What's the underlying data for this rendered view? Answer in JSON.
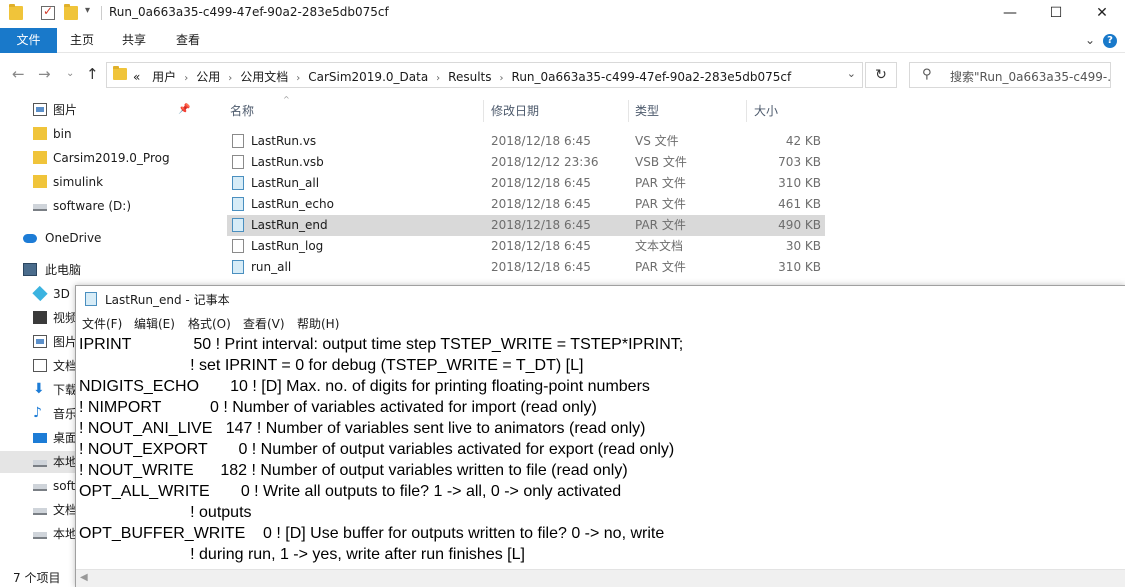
{
  "explorer": {
    "title": "Run_0a663a35-c499-47ef-90a2-283e5db075cf",
    "ribbon_tabs": [
      "文件",
      "主页",
      "共享",
      "查看"
    ],
    "help": "?",
    "address": {
      "lead": "«",
      "crumbs": [
        "用户",
        "公用",
        "公用文档",
        "CarSim2019.0_Data",
        "Results",
        "Run_0a663a35-c499-47ef-90a2-283e5db075cf"
      ]
    },
    "search_placeholder": "搜索\"Run_0a663a35-c499-...",
    "nav_items": [
      {
        "label": "图片",
        "icon": "picture-icon",
        "pinned": true
      },
      {
        "label": "bin",
        "icon": "folder-icon"
      },
      {
        "label": "Carsim2019.0_Prog",
        "icon": "folder-icon"
      },
      {
        "label": "simulink",
        "icon": "folder-icon"
      },
      {
        "label": "software (D:)",
        "icon": "drive-icon"
      },
      {
        "label": "OneDrive",
        "icon": "onedrive-icon"
      },
      {
        "label": "此电脑",
        "icon": "this-pc-icon"
      },
      {
        "label": "3D",
        "icon": "3d-objects-icon"
      },
      {
        "label": "视频",
        "icon": "video-icon"
      },
      {
        "label": "图片",
        "icon": "picture-icon"
      },
      {
        "label": "文档",
        "icon": "document-icon"
      },
      {
        "label": "下载",
        "icon": "download-icon"
      },
      {
        "label": "音乐",
        "icon": "music-icon"
      },
      {
        "label": "桌面",
        "icon": "desktop-icon"
      },
      {
        "label": "本地",
        "icon": "drive-icon",
        "selected": true
      },
      {
        "label": "soft",
        "icon": "drive-icon"
      },
      {
        "label": "文档",
        "icon": "drive-icon"
      },
      {
        "label": "本地",
        "icon": "drive-icon"
      }
    ],
    "columns": [
      "名称",
      "修改日期",
      "类型",
      "大小"
    ],
    "files": [
      {
        "name": "LastRun.vs",
        "date": "2018/12/18 6:45",
        "type": "VS 文件",
        "size": "42 KB",
        "par": false
      },
      {
        "name": "LastRun.vsb",
        "date": "2018/12/12 23:36",
        "type": "VSB 文件",
        "size": "703 KB",
        "par": false
      },
      {
        "name": "LastRun_all",
        "date": "2018/12/18 6:45",
        "type": "PAR 文件",
        "size": "310 KB",
        "par": true
      },
      {
        "name": "LastRun_echo",
        "date": "2018/12/18 6:45",
        "type": "PAR 文件",
        "size": "461 KB",
        "par": true
      },
      {
        "name": "LastRun_end",
        "date": "2018/12/18 6:45",
        "type": "PAR 文件",
        "size": "490 KB",
        "par": true,
        "selected": true
      },
      {
        "name": "LastRun_log",
        "date": "2018/12/18 6:45",
        "type": "文本文档",
        "size": "30 KB",
        "par": false
      },
      {
        "name": "run_all",
        "date": "2018/12/18 6:45",
        "type": "PAR 文件",
        "size": "310 KB",
        "par": true
      }
    ],
    "status": "7 个项目"
  },
  "notepad": {
    "title": "LastRun_end - 记事本",
    "menu": [
      "文件(F)",
      "编辑(E)",
      "格式(O)",
      "查看(V)",
      "帮助(H)"
    ],
    "lines": [
      "IPRINT              50 ! Print interval: output time step TSTEP_WRITE = TSTEP*IPRINT;",
      "                         ! set IPRINT = 0 for debug (TSTEP_WRITE = T_DT) [L]",
      "NDIGITS_ECHO       10 ! [D] Max. no. of digits for printing floating-point numbers",
      "! NIMPORT           0 ! Number of variables activated for import (read only)",
      "! NOUT_ANI_LIVE   147 ! Number of variables sent live to animators (read only)",
      "! NOUT_EXPORT       0 ! Number of output variables activated for export (read only)",
      "! NOUT_WRITE      182 ! Number of output variables written to file (read only)",
      "OPT_ALL_WRITE       0 ! Write all outputs to file? 1 -> all, 0 -> only activated",
      "                         ! outputs",
      "OPT_BUFFER_WRITE    0 ! [D] Use buffer for outputs written to file? 0 -> no, write",
      "                         ! during run, 1 -> yes, write after run finishes [L]"
    ]
  }
}
